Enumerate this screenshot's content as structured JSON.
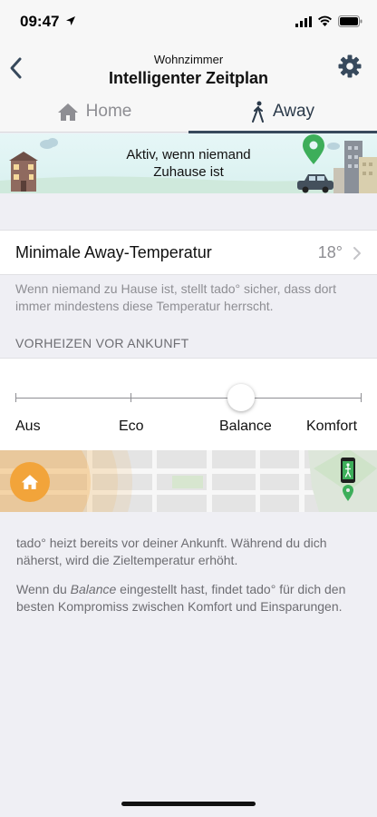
{
  "status_bar": {
    "time": "09:47"
  },
  "nav": {
    "subtitle": "Wohnzimmer",
    "title": "Intelligenter Zeitplan"
  },
  "tabs": [
    {
      "label": "Home",
      "icon": "house-icon",
      "active": false
    },
    {
      "label": "Away",
      "icon": "walking-person-icon",
      "active": true
    }
  ],
  "banner": {
    "text": "Aktiv, wenn niemand Zuhause ist"
  },
  "min_temp": {
    "label": "Minimale Away-Temperatur",
    "value": "18°",
    "description": "Wenn niemand zu Hause ist, stellt tado° sicher, dass dort immer mindestens diese Temperatur herrscht."
  },
  "preheat": {
    "header": "VORHEIZEN VOR ANKUNFT",
    "options": [
      "Aus",
      "Eco",
      "Balance",
      "Komfort"
    ],
    "selected_index": 2
  },
  "info": {
    "paragraph1": "tado° heizt bereits vor deiner Ankunft. Während du dich näherst, wird die Zieltemperatur erhöht.",
    "p2_prefix": "Wenn du ",
    "p2_emphasis": "Balance",
    "p2_suffix": " eingestellt hast, findet tado° für dich den besten Kompromiss zwischen Komfort und Einsparungen."
  },
  "colors": {
    "accent_orange": "#f2a43a",
    "map_pin_green": "#3dae5a",
    "tab_active": "#37495c"
  }
}
